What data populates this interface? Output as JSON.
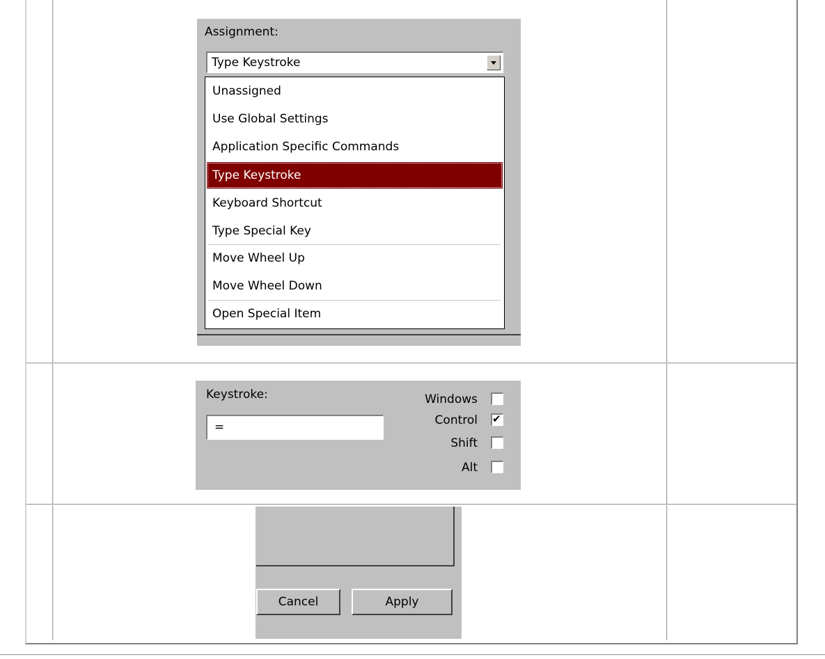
{
  "assignment": {
    "label": "Assignment:",
    "selected_value": "Type Keystroke",
    "options": [
      "Unassigned",
      "Use Global Settings",
      "Application Specific Commands",
      "Type Keystroke",
      "Keyboard Shortcut",
      "Type Special Key",
      "Move Wheel Up",
      "Move Wheel Down",
      "Open Special Item"
    ],
    "highlight_color": "#800000"
  },
  "keystroke": {
    "label": "Keystroke:",
    "value": "=",
    "modifiers": [
      {
        "label": "Windows",
        "checked": false
      },
      {
        "label": "Control",
        "checked": true
      },
      {
        "label": "Shift",
        "checked": false
      },
      {
        "label": "Alt",
        "checked": false
      }
    ]
  },
  "buttons": {
    "cancel_label": "Cancel",
    "apply_label": "Apply"
  }
}
